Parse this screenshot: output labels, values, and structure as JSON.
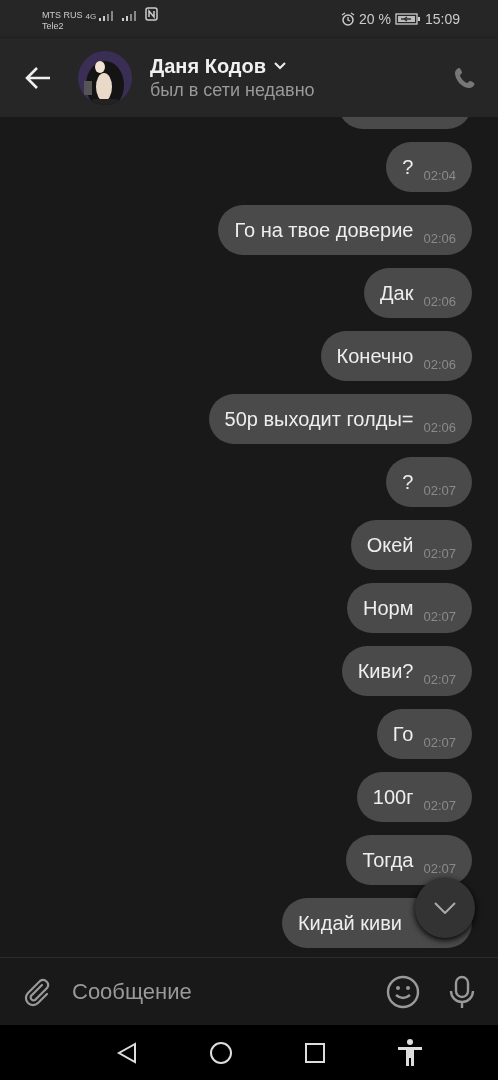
{
  "status_bar": {
    "carrier_1": "MTS RUS",
    "network_1": "4G",
    "carrier_2": "Tele2",
    "battery": "20 %",
    "time": "15:09"
  },
  "header": {
    "name": "Даня Кодов",
    "status": "был в сети недавно"
  },
  "messages": [
    {
      "text": "?",
      "time": "02:04"
    },
    {
      "text": "Го на твое доверие",
      "time": "02:06"
    },
    {
      "text": "Дак",
      "time": "02:06"
    },
    {
      "text": "Конечно",
      "time": "02:06"
    },
    {
      "text": "50р выходит голды=",
      "time": "02:06"
    },
    {
      "text": "?",
      "time": "02:07"
    },
    {
      "text": "Окей",
      "time": "02:07"
    },
    {
      "text": "Норм",
      "time": "02:07"
    },
    {
      "text": "Киви?",
      "time": "02:07"
    },
    {
      "text": "Го",
      "time": "02:07"
    },
    {
      "text": "100г",
      "time": "02:07"
    },
    {
      "text": "Тогда",
      "time": "02:07"
    },
    {
      "text": "Кидай киви"
    }
  ],
  "composer": {
    "placeholder": "Сообщение"
  }
}
